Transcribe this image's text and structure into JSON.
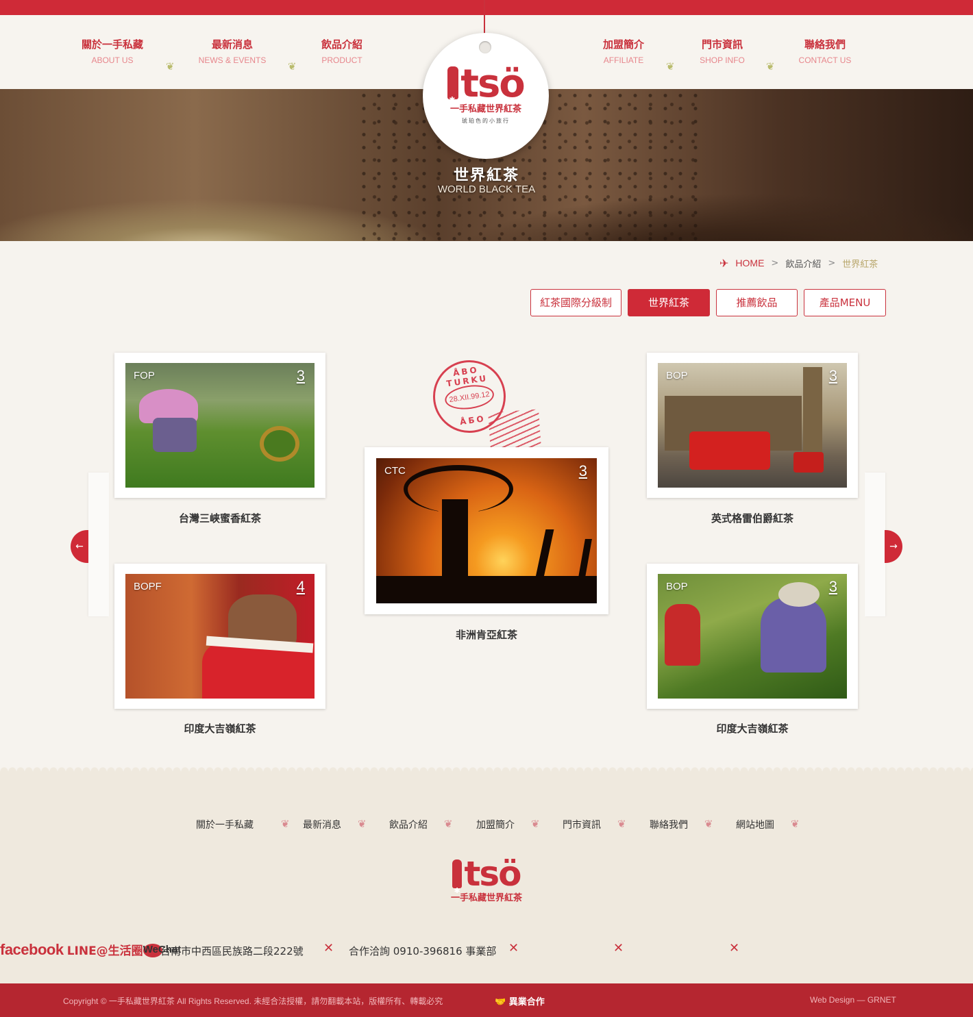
{
  "nav_left": [
    {
      "zh": "關於一手私藏",
      "en": "ABOUT US"
    },
    {
      "zh": "最新消息",
      "en": "NEWS & EVENTS"
    },
    {
      "zh": "飲品介紹",
      "en": "PRODUCT"
    }
  ],
  "nav_right": [
    {
      "zh": "加盟簡介",
      "en": "AFFILIATE"
    },
    {
      "zh": "門市資訊",
      "en": "SHOP INFO"
    },
    {
      "zh": "聯絡我們",
      "en": "CONTACT US"
    }
  ],
  "logo": {
    "word": "tsö",
    "name": "一手私藏世界紅茶",
    "tagline": "琥珀色的小旅行"
  },
  "hero": {
    "title": "世界紅茶",
    "subtitle": "WORLD BLACK TEA"
  },
  "breadcrumb": {
    "home": "HOME",
    "parent": "飲品介紹",
    "current": "世界紅茶",
    "separator": ">"
  },
  "tabs": [
    {
      "label": "紅茶國際分級制",
      "active": false
    },
    {
      "label": "世界紅茶",
      "active": true
    },
    {
      "label": "推薦飲品",
      "active": false
    },
    {
      "label": "產品MENU",
      "active": false
    }
  ],
  "stamps": [
    {
      "grade": "FOP",
      "num": "3",
      "caption": "台灣三峽蜜香紅茶"
    },
    {
      "grade": "BOP",
      "num": "3",
      "caption": "英式格雷伯爵紅茶"
    },
    {
      "grade": "CTC",
      "num": "3",
      "caption": "非洲肯亞紅茶"
    },
    {
      "grade": "BOPF",
      "num": "4",
      "caption": "印度大吉嶺紅茶"
    },
    {
      "grade": "BOP",
      "num": "3",
      "caption": "印度大吉嶺紅茶"
    }
  ],
  "postmark": {
    "top": "ÅBO TURKU",
    "date": "28.XII.99.12",
    "bottom": "ÅБО"
  },
  "carousel": {
    "prev": "←",
    "next": "→"
  },
  "footer_nav": [
    "關於一手私藏",
    "最新消息",
    "飲品介紹",
    "加盟簡介",
    "門市資訊",
    "聯絡我們",
    "網站地圖"
  ],
  "footer_logo": {
    "word": "tsö",
    "name": "一手私藏世界紅茶"
  },
  "contact": {
    "address": "台南市中西區民族路二段222號",
    "phone": "合作洽詢 0910-396816 事業部",
    "facebook": "facebook",
    "line": "LINE@生活圈",
    "wechat": "WeChat",
    "separator": "✕"
  },
  "bottom_bar": {
    "copyright": "Copyright © 一手私藏世界紅茶 All Rights Reserved. 未經合法授權，請勿翻載本站，版權所有、轉載必究",
    "cooperation": "異業合作",
    "design": "Web Design  —  GRNET"
  },
  "colors": {
    "brand_red": "#cf2a37",
    "dark_red": "#b52630",
    "paper": "#f6f3ee",
    "leaf_green": "#b9bb6c"
  }
}
